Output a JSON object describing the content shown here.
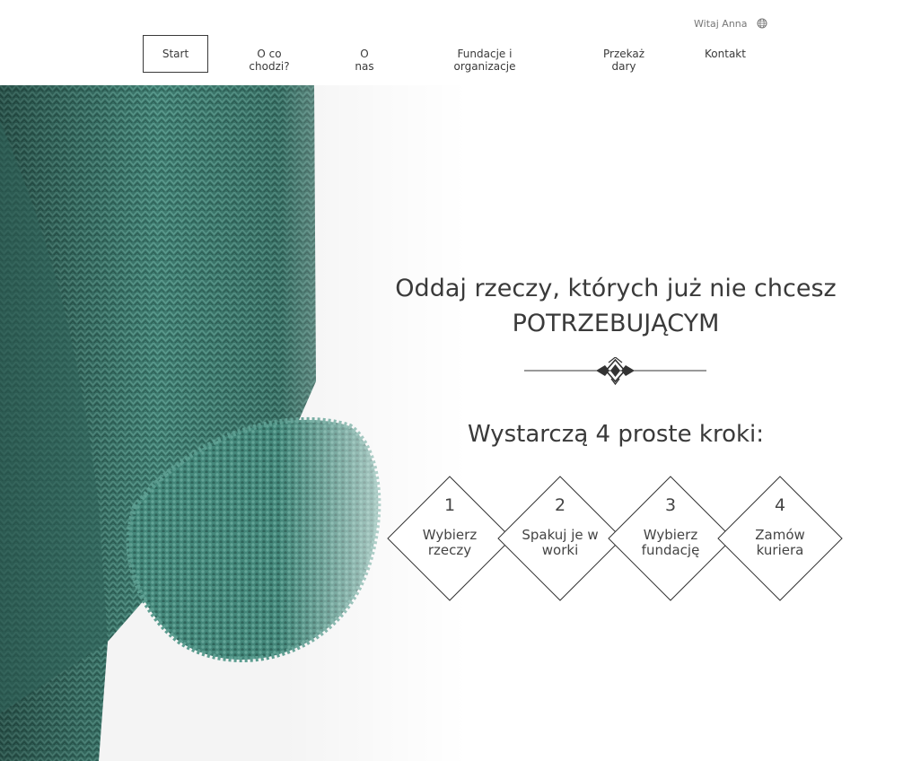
{
  "header": {
    "greeting": "Witaj Anna",
    "user_icon": "globe-icon"
  },
  "nav": {
    "items": [
      {
        "line1": "Start",
        "line2": ""
      },
      {
        "line1": "O co",
        "line2": "chodzi?"
      },
      {
        "line1": "O",
        "line2": "nas"
      },
      {
        "line1": "Fundacje i",
        "line2": "organizacje"
      },
      {
        "line1": "Przekaż",
        "line2": "dary"
      },
      {
        "line1": "Kontakt",
        "line2": ""
      }
    ],
    "active": "Start"
  },
  "hero": {
    "headline_line1": "Oddaj rzeczy, których już nie chcesz",
    "headline_line2": "POTRZEBUJĄCYM",
    "steps_title": "Wystarczą 4 proste kroki:",
    "steps": [
      {
        "number": "1",
        "line1": "Wybierz",
        "line2": "rzeczy"
      },
      {
        "number": "2",
        "line1": "Spakuj je w",
        "line2": "worki"
      },
      {
        "number": "3",
        "line1": "Wybierz",
        "line2": "fundację"
      },
      {
        "number": "4",
        "line1": "Zamów",
        "line2": "kuriera"
      }
    ]
  },
  "colors": {
    "text": "#3a3a3a",
    "sweater": "#3f7f73",
    "line": "#333333"
  }
}
